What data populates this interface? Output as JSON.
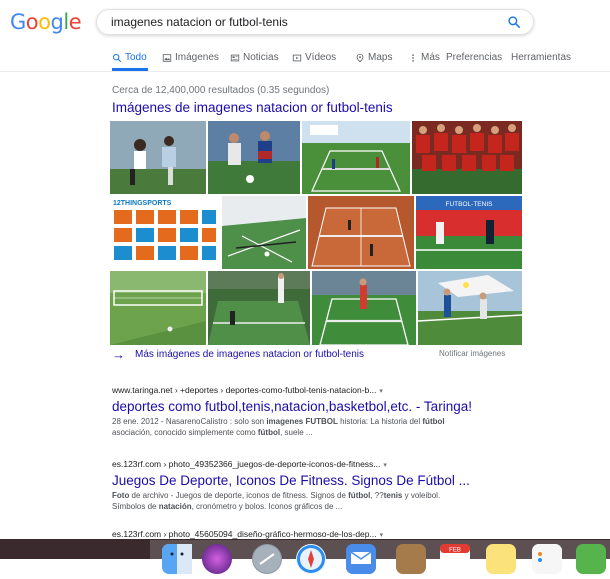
{
  "logo": {
    "letters": [
      "G",
      "o",
      "o",
      "g",
      "l",
      "e"
    ],
    "colors": [
      "#4285F4",
      "#EA4335",
      "#FBBC05",
      "#4285F4",
      "#34A853",
      "#EA4335"
    ]
  },
  "search": {
    "query": "imagenes natacion or futbol-tenis",
    "icon": "search-icon",
    "accent": "#1a73e8"
  },
  "tabs": [
    {
      "label": "Todo",
      "icon": "search-icon",
      "active": true
    },
    {
      "label": "Imágenes",
      "icon": "image-icon",
      "active": false
    },
    {
      "label": "Noticias",
      "icon": "news-icon",
      "active": false
    },
    {
      "label": "Vídeos",
      "icon": "video-icon",
      "active": false
    },
    {
      "label": "Maps",
      "icon": "map-pin-icon",
      "active": false
    },
    {
      "label": "Más",
      "icon": "more-vert-icon",
      "active": false
    },
    {
      "label": "Preferencias",
      "active": false
    },
    {
      "label": "Herramientas",
      "active": false
    }
  ],
  "stats": "Cerca de 12,400,000 resultados (0.35 segundos)",
  "images": {
    "heading": "Imágenes de imagenes natacion or futbol-tenis",
    "more": "Más imágenes de imagenes natacion or futbol-tenis",
    "report": "Notificar imágenes",
    "sticker_text": "12THINGSPORTS",
    "banner_text": "FUTBOL-TENIS"
  },
  "results": [
    {
      "crumb": "www.taringa.net › +deportes › deportes-como-futbol-tenis-natacion-b...",
      "title": "deportes como futbol,tenis,natacion,basketbol,etc. - Taringa!",
      "snippet_date": "28 ene. 2012 - NasarenoCalistro : solo son ",
      "snippet_b1": "imagenes FUTBOL",
      "snippet_mid": " historia: La historia del ",
      "snippet_b2": "fútbol",
      "snippet_line2": "asociación, conocido simplemente como ",
      "snippet_b3": "fútbol",
      "snippet_end": ", suele ..."
    },
    {
      "crumb": "es.123rf.com › photo_49352366_juegos-de-deporte-iconos-de-fitness...",
      "title": "Juegos De Deporte, Iconos De Fitness. Signos De Fútbol ...",
      "s_a": "Foto",
      "s_b": " de archivo - Juegos de deporte, iconos de fitness. Signos de ",
      "s_c": "fútbol",
      "s_d": ", ??",
      "s_e": "tenis",
      "s_f": " y voleibol.",
      "s_g": "Símbolos de ",
      "s_h": "natación",
      "s_i": ", cronómetro y bolos. Iconos gráficos de ..."
    },
    {
      "crumb": "es.123rf.com › photo_45605094_diseño-gráfico-hermoso-de-los-dep..."
    }
  ],
  "dock": {
    "calendar_label": "FEB"
  }
}
